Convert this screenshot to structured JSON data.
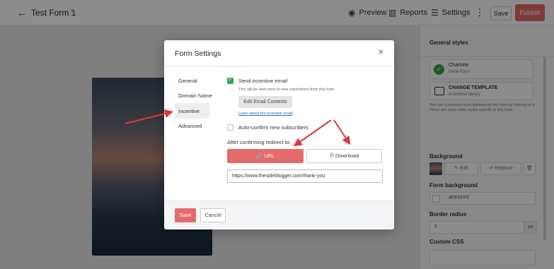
{
  "topbar": {
    "back_icon": "arrow-left-icon",
    "title": "Test Form 1",
    "edit_icon": "pencil-icon",
    "preview_label": "Preview",
    "reports_label": "Reports",
    "settings_label": "Settings",
    "more_icon": "kebab-icon",
    "save_label": "Save",
    "publish_label": "Publish"
  },
  "panel": {
    "title": "General styles",
    "theme": {
      "name": "Charlotte",
      "sub": "Inline Form"
    },
    "template": {
      "name": "CHANGE TEMPLATE",
      "sub": "or browse library"
    },
    "help": "You can customize each element on the form by clicking on it. There are some other styles specific to this form.",
    "background_label": "Background",
    "edit_label": "Edit",
    "replace_label": "Replace",
    "form_background_label": "Form background",
    "form_background_value": "#FFFFFF",
    "border_radius_label": "Border radius",
    "border_radius_value": "5",
    "border_radius_unit": "px",
    "custom_css_label": "Custom CSS"
  },
  "modal": {
    "title": "Form Settings",
    "close_icon": "close-icon",
    "sidebar": [
      "General",
      "Domain Name",
      "Incentive",
      "Advanced"
    ],
    "active_item": "Incentive",
    "send_incentive": {
      "label": "Send incentive email",
      "checked": true
    },
    "incentive_help": "This will be sent once to new subscribers from this form.",
    "edit_email_label": "Edit Email Contents",
    "learn_link": "Learn about the incentive email",
    "auto_confirm": {
      "label": "Auto-confirm new subscribers",
      "checked": false
    },
    "redirect_label": "After confirming redirect to:",
    "tab_url": "URL",
    "tab_download": "Download",
    "url_value": "https://www.thesideblogger.com/thank-you",
    "save_label": "Save",
    "cancel_label": "Cancel"
  },
  "colors": {
    "accent": "#e46a6b",
    "check": "#2fa84f",
    "arrow": "#e0353a"
  }
}
